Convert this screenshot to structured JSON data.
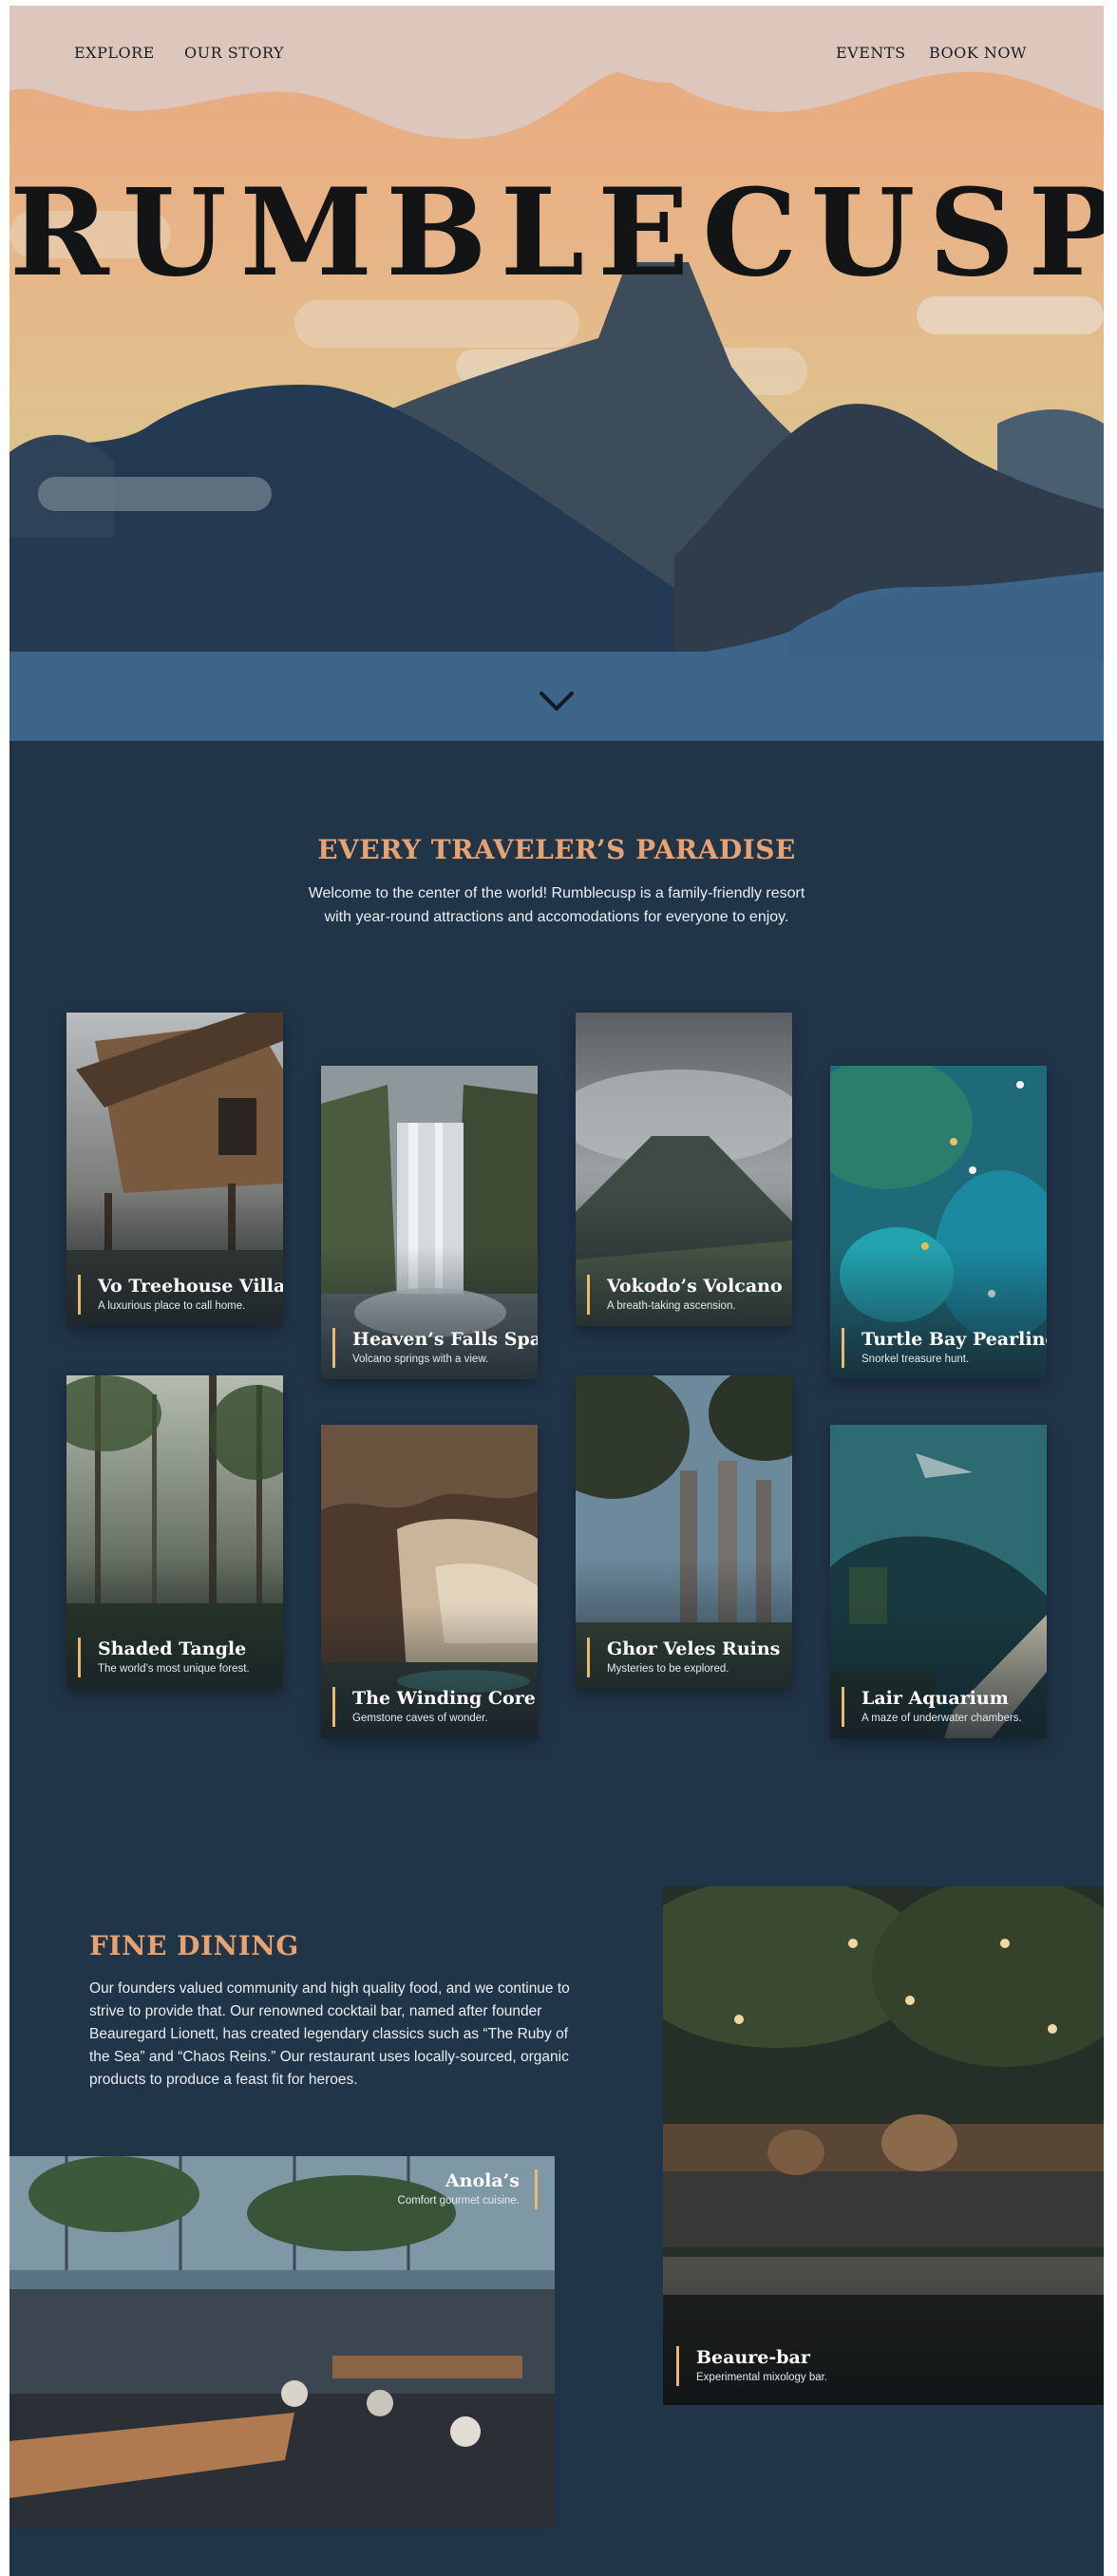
{
  "nav": {
    "explore": "EXPLORE",
    "our_story": "OUR STORY",
    "events": "EVENTS",
    "book_now": "BOOK NOW"
  },
  "hero": {
    "brand": "RUMBLECUSP",
    "scroll_icon": "chevron-down-icon"
  },
  "paradise": {
    "title": "EVERY TRAVELER’S PARADISE",
    "body_line1": "Welcome to the center of the world! Rumblecusp is a family-friendly resort",
    "body_line2": "with year-round attractions and accomodations for everyone to enjoy.",
    "cards": [
      {
        "title": "Vo Treehouse Villas",
        "subtitle": "A luxurious place to call home."
      },
      {
        "title": "Heaven’s Falls Spa",
        "subtitle": "Volcano springs with a view."
      },
      {
        "title": "Vokodo’s Volcano",
        "subtitle": "A breath-taking ascension."
      },
      {
        "title": "Turtle Bay Pearling",
        "subtitle": "Snorkel treasure hunt."
      },
      {
        "title": "Shaded Tangle",
        "subtitle": "The world’s most unique forest."
      },
      {
        "title": "The Winding Core",
        "subtitle": "Gemstone caves of wonder."
      },
      {
        "title": "Ghor Veles Ruins",
        "subtitle": "Mysteries to be explored."
      },
      {
        "title": "Lair Aquarium",
        "subtitle": "A maze of underwater chambers."
      }
    ]
  },
  "dining": {
    "title": "FINE DINING",
    "body": [
      "Our founders valued community and high quality food, and we continue to",
      "strive to provide that. Our renowned cocktail bar, named after founder",
      "Beauregard Lionett, has created legendary classics such as “The Ruby of",
      "the Sea” and “Chaos Reins.” Our restaurant uses locally-sourced, organic",
      "products to produce a feast fit for heroes."
    ],
    "anola": {
      "title": "Anola’s",
      "subtitle": "Comfort gourmet cuisine."
    },
    "beaure": {
      "title": "Beaure-bar",
      "subtitle": "Experimental mixology bar."
    }
  },
  "colors": {
    "page_bg": "#213549",
    "accent": "#e8a271",
    "caption_bar": "#e9b96e",
    "sky_top": "#ddc6bb",
    "water": "#3d6589"
  }
}
